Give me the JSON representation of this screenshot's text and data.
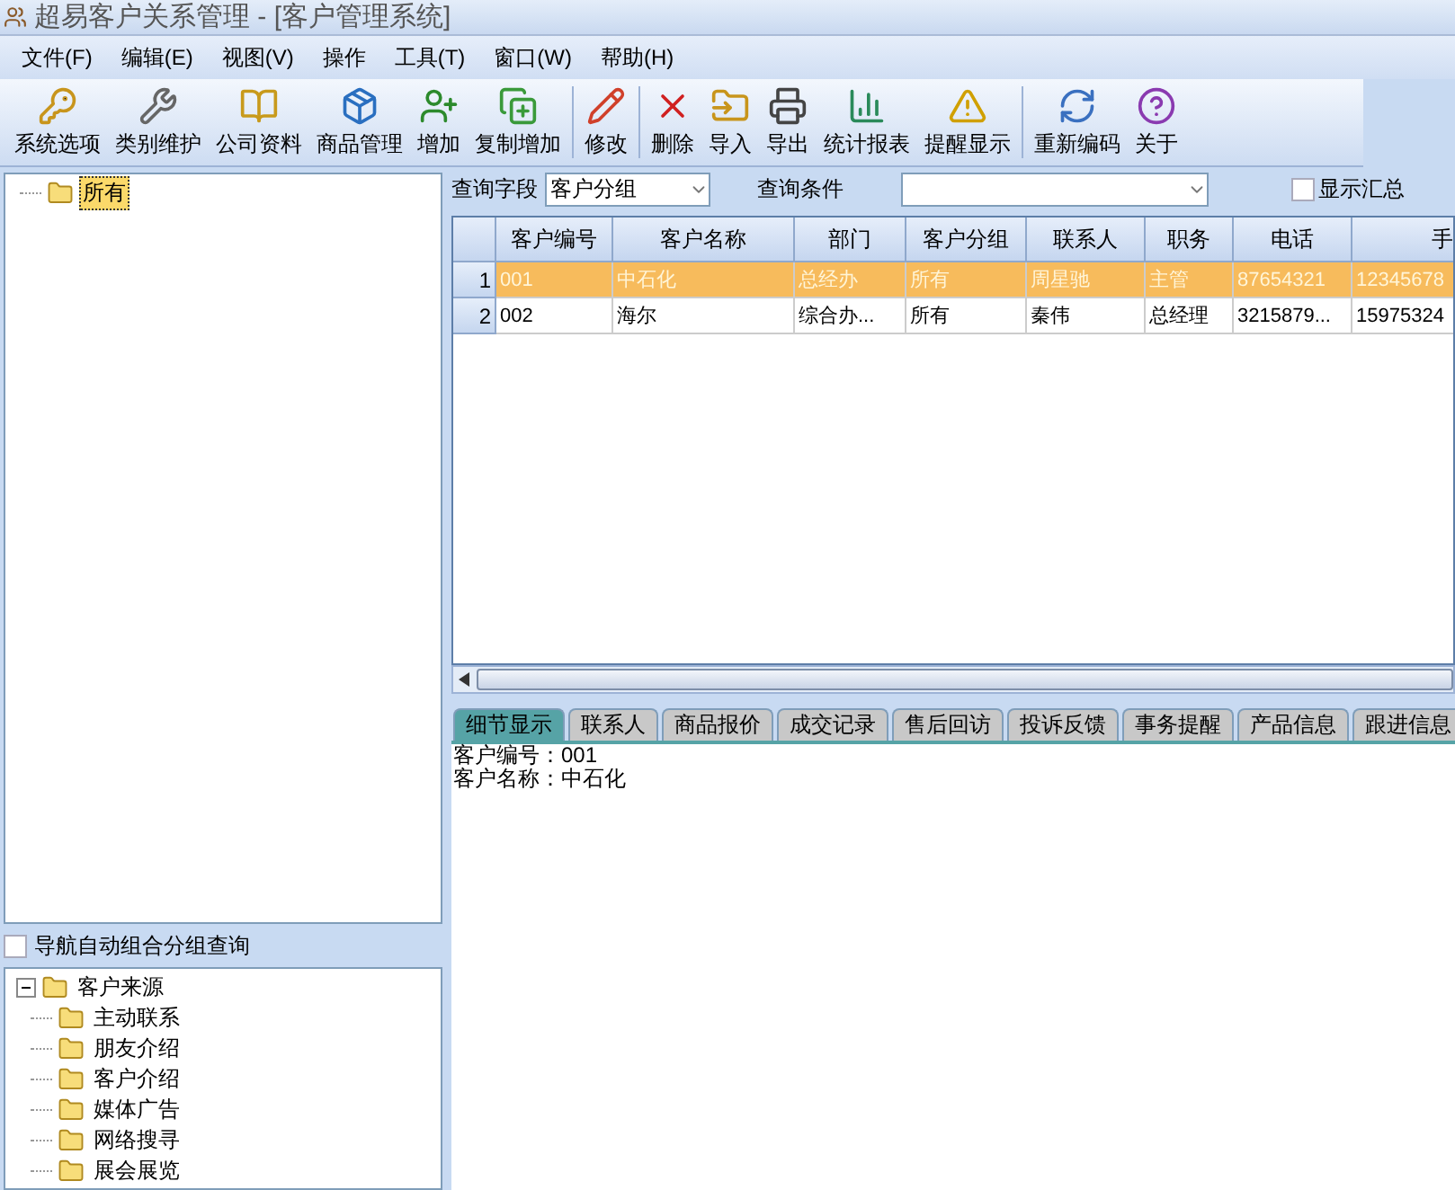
{
  "window": {
    "title": "超易客户关系管理 - [客户管理系统]"
  },
  "menu": [
    "文件(F)",
    "编辑(E)",
    "视图(V)",
    "操作",
    "工具(T)",
    "窗口(W)",
    "帮助(H)"
  ],
  "toolbar": [
    {
      "label": "系统选项",
      "kind": "key"
    },
    {
      "label": "类别维护",
      "kind": "tools"
    },
    {
      "label": "公司资料",
      "kind": "book"
    },
    {
      "label": "商品管理",
      "kind": "box"
    },
    {
      "label": "增加",
      "kind": "useradd"
    },
    {
      "label": "复制增加",
      "kind": "copyadd"
    },
    {
      "label": "修改",
      "kind": "pencil",
      "sep": true
    },
    {
      "label": "删除",
      "kind": "delete",
      "sep": true
    },
    {
      "label": "导入",
      "kind": "import"
    },
    {
      "label": "导出",
      "kind": "print"
    },
    {
      "label": "统计报表",
      "kind": "chart"
    },
    {
      "label": "提醒显示",
      "kind": "alert"
    },
    {
      "label": "重新编码",
      "kind": "recode",
      "sep": true
    },
    {
      "label": "关于",
      "kind": "help"
    }
  ],
  "nav_tree": [
    {
      "label": "所有",
      "selected": true
    }
  ],
  "auto_group": {
    "label": "导航自动组合分组查询",
    "checked": false
  },
  "source_tree": [
    {
      "label": "客户来源",
      "expanded": true,
      "children": [
        {
          "label": "主动联系"
        },
        {
          "label": "朋友介绍"
        },
        {
          "label": "客户介绍"
        },
        {
          "label": "媒体广告"
        },
        {
          "label": "网络搜寻"
        },
        {
          "label": "展会展览"
        }
      ]
    }
  ],
  "query": {
    "field_label": "查询字段",
    "field_value": "客户分组",
    "condition_label": "查询条件",
    "show_summary": {
      "label": "显示汇总",
      "checked": false
    }
  },
  "table": {
    "columns": [
      "客户编号",
      "客户名称",
      "部门",
      "客户分组",
      "联系人",
      "职务",
      "电话",
      "手"
    ],
    "rows": [
      {
        "number": "1",
        "selected": true,
        "cells": [
          "001",
          "中石化",
          "总经办",
          "所有",
          "周星驰",
          "主管",
          "87654321",
          "12345678"
        ]
      },
      {
        "number": "2",
        "selected": false,
        "cells": [
          "002",
          "海尔",
          "综合办...",
          "所有",
          "秦伟",
          "总经理",
          "3215879...",
          "15975324"
        ]
      }
    ]
  },
  "detail_tabs": [
    {
      "label": "细节显示",
      "selected": true
    },
    {
      "label": "联系人",
      "selected": false
    },
    {
      "label": "商品报价",
      "selected": false
    },
    {
      "label": "成交记录",
      "selected": false
    },
    {
      "label": "售后回访",
      "selected": false
    },
    {
      "label": "投诉反馈",
      "selected": false
    },
    {
      "label": "事务提醒",
      "selected": false
    },
    {
      "label": "产品信息",
      "selected": false
    },
    {
      "label": "跟进信息",
      "selected": false
    }
  ],
  "detail_lines": [
    "客户编号：001",
    "客户名称：中石化"
  ]
}
